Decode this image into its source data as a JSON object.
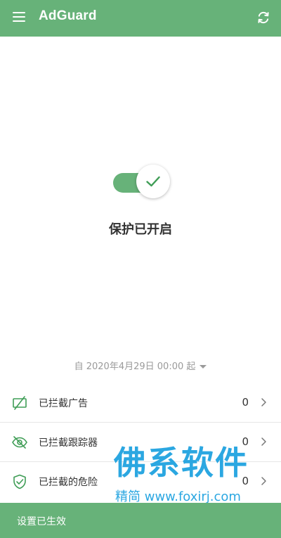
{
  "appbar": {
    "title": "AdGuard",
    "menu_icon": "hamburger-menu-icon",
    "refresh_icon": "refresh-icon"
  },
  "protection": {
    "enabled": true,
    "status_text": "保护已开启",
    "toggle_icon": "checkmark-icon"
  },
  "period": {
    "text": "自 2020年4月29日 00:00 起",
    "dropdown_icon": "caret-down-icon"
  },
  "stats": [
    {
      "label": "已拦截广告",
      "value": "0",
      "icon": "ad-blocked-icon"
    },
    {
      "label": "已拦截跟踪器",
      "value": "0",
      "icon": "eye-off-icon"
    },
    {
      "label": "已拦截的危险",
      "value": "0",
      "icon": "shield-check-icon"
    }
  ],
  "snackbar": {
    "message": "设置已生效"
  },
  "watermark": {
    "title": "佛系软件",
    "subtitle": "精简 www.foxirj.com"
  },
  "colors": {
    "brand_green": "#67b279",
    "icon_green": "#3f9d56",
    "watermark_blue": "#1aa0df"
  }
}
